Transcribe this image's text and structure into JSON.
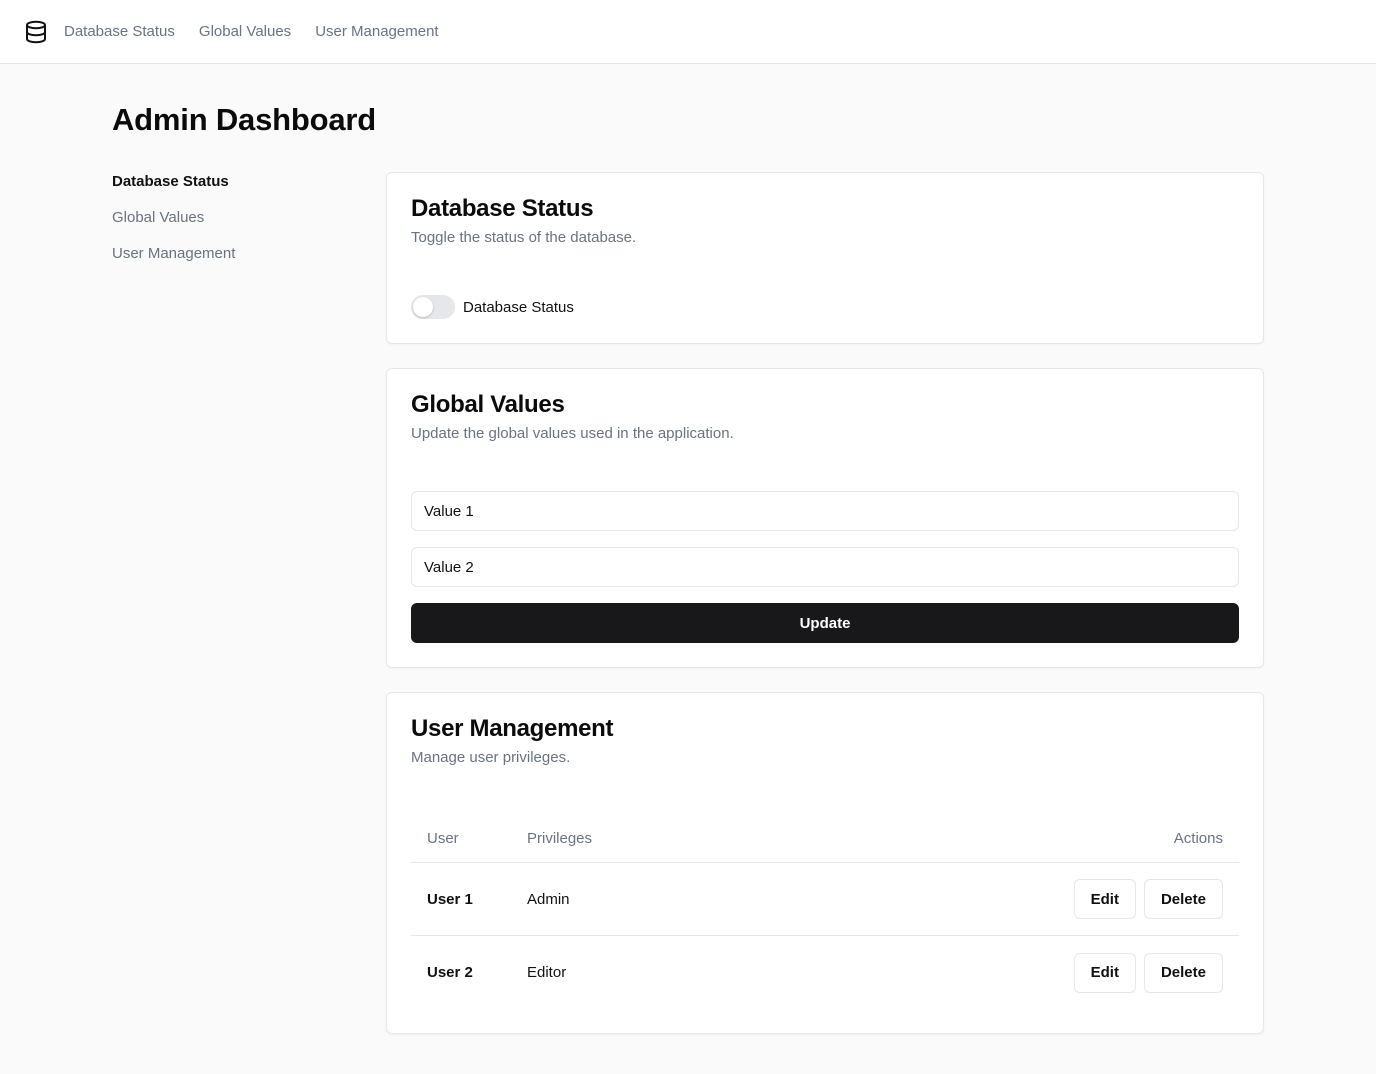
{
  "topnav": {
    "logo_icon": "database-icon",
    "links": [
      "Database Status",
      "Global Values",
      "User Management"
    ]
  },
  "page": {
    "title": "Admin Dashboard"
  },
  "sidenav": {
    "items": [
      "Database Status",
      "Global Values",
      "User Management"
    ],
    "active": "Database Status"
  },
  "database_status": {
    "title": "Database Status",
    "description": "Toggle the status of the database.",
    "toggle_label": "Database Status",
    "toggle_on": false
  },
  "global_values": {
    "title": "Global Values",
    "description": "Update the global values used in the application.",
    "value1": "Value 1",
    "value2": "Value 2",
    "update_label": "Update"
  },
  "user_management": {
    "title": "User Management",
    "description": "Manage user privileges.",
    "columns": {
      "user": "User",
      "privileges": "Privileges",
      "actions": "Actions"
    },
    "rows": [
      {
        "user": "User 1",
        "privileges": "Admin",
        "edit_label": "Edit",
        "delete_label": "Delete"
      },
      {
        "user": "User 2",
        "privileges": "Editor",
        "edit_label": "Edit",
        "delete_label": "Delete"
      }
    ]
  },
  "colors": {
    "primary_button": "#18181b",
    "background": "#f9faf9",
    "border": "#e5e7eb",
    "muted_text": "#6b7280"
  }
}
